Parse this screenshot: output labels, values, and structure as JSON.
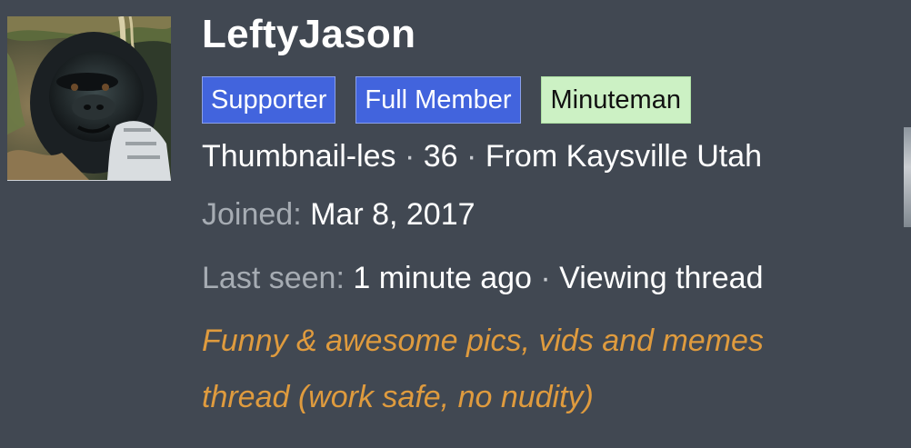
{
  "profile": {
    "username": "LeftyJason",
    "badges": [
      {
        "label": "Supporter"
      },
      {
        "label": "Full Member"
      },
      {
        "label": "Minuteman"
      }
    ],
    "meta": {
      "title": "Thumbnail-les",
      "age": "36",
      "location": "From Kaysville Utah",
      "separator": "·"
    },
    "joined": {
      "label": "Joined:",
      "value": "Mar 8, 2017"
    },
    "last_seen": {
      "label": "Last seen:",
      "value": "1 minute ago",
      "activity": "Viewing thread"
    },
    "thread_link": "Funny & awesome pics, vids and memes thread (work safe, no nudity)"
  },
  "colors": {
    "background": "#414852",
    "badge_blue": "#4264dd",
    "badge_green": "#ccf1c4",
    "link_orange": "#df9b3e",
    "muted_text": "#a6acb3"
  },
  "icons": {
    "avatar": "gorilla-avatar-image"
  }
}
